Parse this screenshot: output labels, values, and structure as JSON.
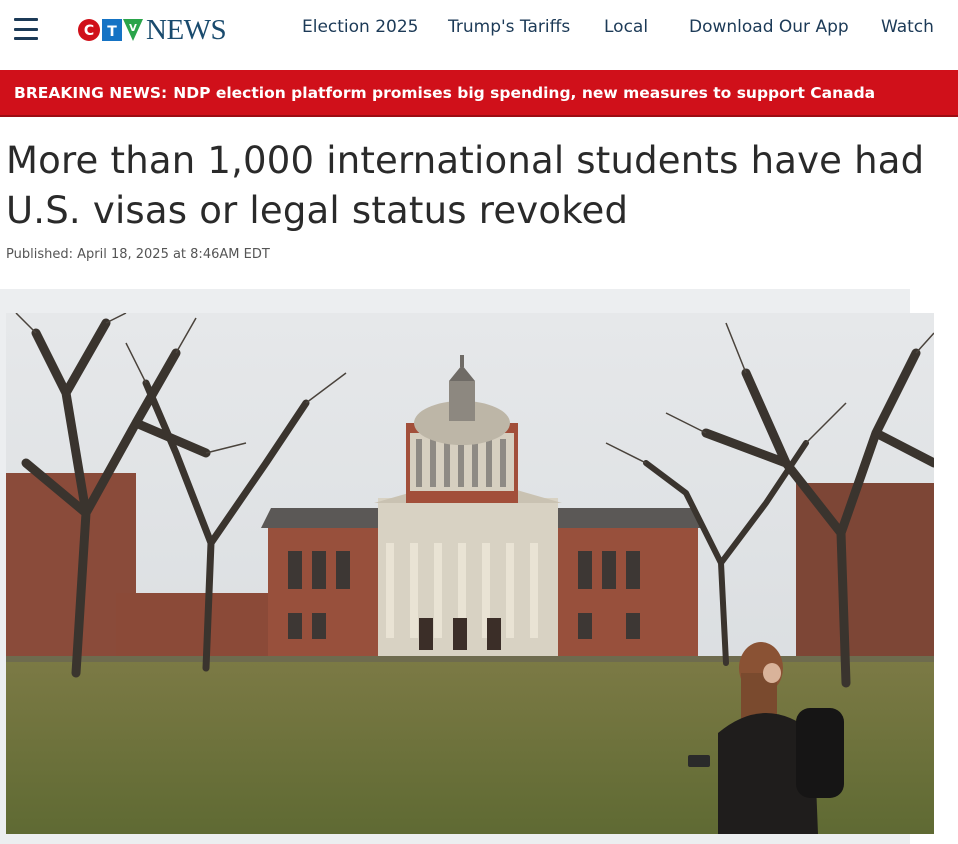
{
  "header": {
    "logo": {
      "letters": [
        "C",
        "T",
        "V"
      ],
      "wordmark": "NEWS"
    },
    "nav": [
      {
        "label": "Election 2025"
      },
      {
        "label": "Trump's Tariffs"
      },
      {
        "label": "Local"
      },
      {
        "label": "Download Our App"
      },
      {
        "label": "Watch"
      }
    ],
    "menu_icon": "hamburger-menu-icon"
  },
  "breaking": {
    "label": "BREAKING NEWS:",
    "text": "NDP election platform promises big spending, new measures to support Canada"
  },
  "article": {
    "headline": "More than 1,000 international students have had U.S. visas or legal status revoked",
    "published": "Published: April 18, 2025 at 8:46AM EDT"
  },
  "colors": {
    "brand_red": "#d0101a",
    "nav_text": "#1c3a57",
    "headline_text": "#2a2a2a"
  }
}
